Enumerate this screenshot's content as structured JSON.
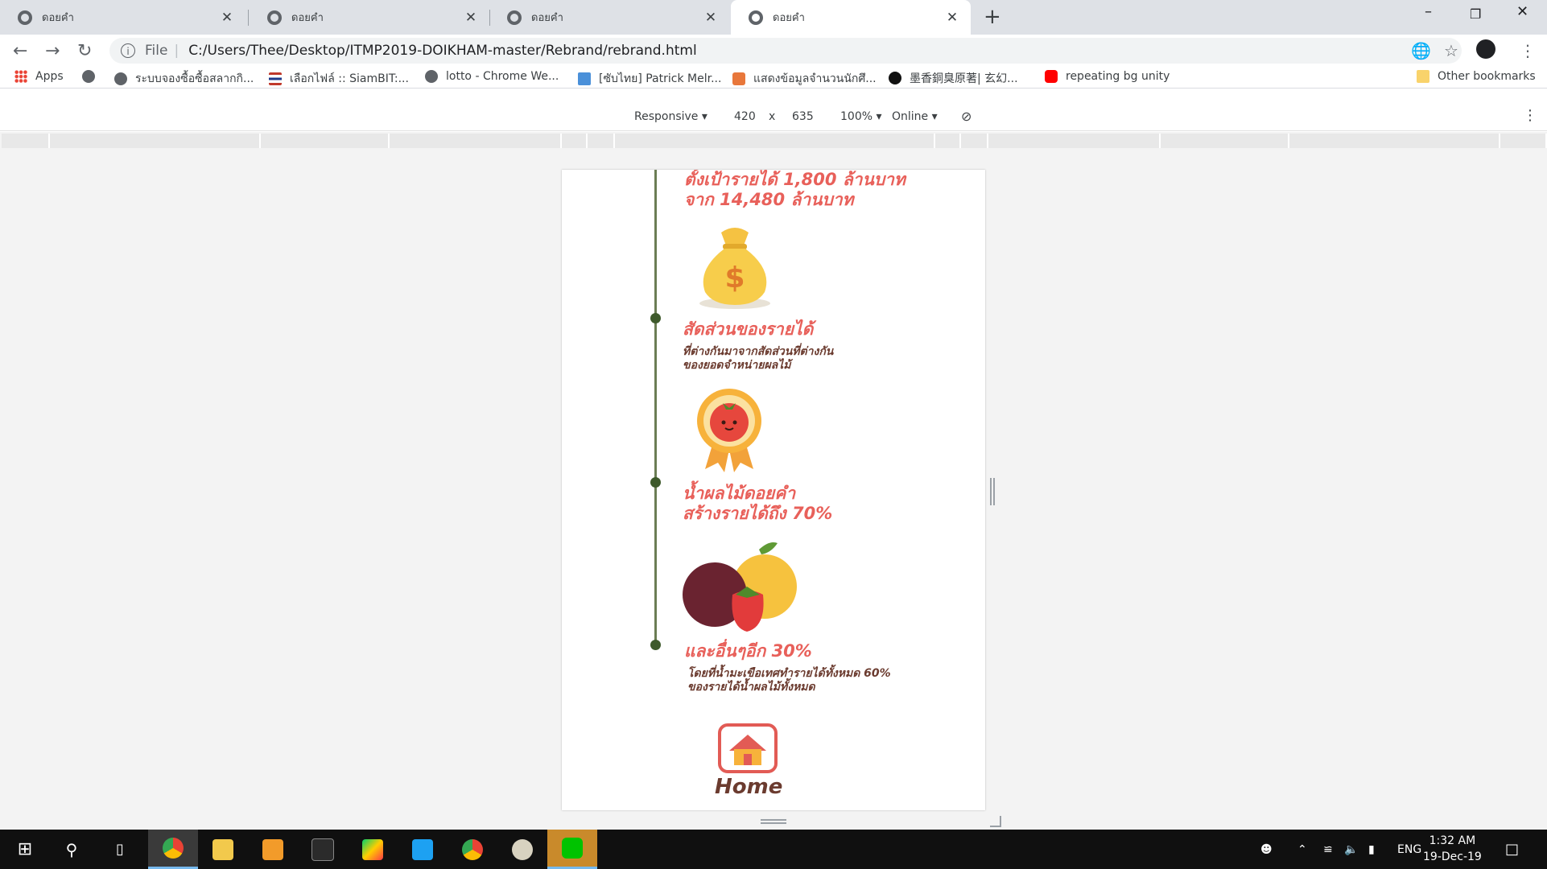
{
  "browser": {
    "tabs": [
      {
        "label": "ดอยคำ",
        "active": false
      },
      {
        "label": "ดอยคำ",
        "active": false
      },
      {
        "label": "ดอยคำ",
        "active": false
      },
      {
        "label": "ดอยคำ",
        "active": true
      }
    ],
    "tab_close_glyph": "✕",
    "new_tab_glyph": "+",
    "address": {
      "scheme_label": "File",
      "url": "C:/Users/Thee/Desktop/ITMP2019-DOIKHAM-master/Rebrand/rebrand.html"
    },
    "bookmarks": [
      {
        "label": "Apps",
        "icon": "apps-grid-icon"
      },
      {
        "label": "",
        "icon": "globe-icon"
      },
      {
        "label": "ระบบจองซื้อซื้อสลากกิ...",
        "icon": "globe-icon"
      },
      {
        "label": "เลือกไฟล์ :: SiamBIT:...",
        "icon": "thai-flag-icon"
      },
      {
        "label": "lotto - Chrome We...",
        "icon": "globe-icon"
      },
      {
        "label": "[ซับไทย] Patrick Melr...",
        "icon": "bc-icon"
      },
      {
        "label": "แสดงข้อมูลจำนวนนักศึ...",
        "icon": "chart-icon"
      },
      {
        "label": "墨香銅臭原著| 玄幻...",
        "icon": "cat-icon"
      },
      {
        "label": "repeating bg unity",
        "icon": "youtube-icon"
      }
    ],
    "other_bookmarks": "Other bookmarks"
  },
  "devtools": {
    "device_mode": "Responsive",
    "width": "420",
    "times": "x",
    "height": "635",
    "zoom": "100%",
    "throttle": "Online"
  },
  "page": {
    "income_goal_line1": "ตั้งเป้ารายได้ 1,800 ล้านบาท",
    "income_goal_line2": "จาก 14,480 ล้านบาท",
    "ratio_title": "สัดส่วนของรายได้",
    "ratio_desc_line1": "ที่ต่างกันมาจากสัดส่วนที่ต่างกัน",
    "ratio_desc_line2": "ของยอดจำหน่ายผลไม้",
    "juice_line1": "น้ำผลไม้ดอยคำ",
    "juice_line2": "สร้างรายได้ถึง 70%",
    "others_title": "และอื่นๆอีก 30%",
    "others_desc_line1": "โดยที่น้ำมะเขือเทศทำรายได้ทั้งหมด 60%",
    "others_desc_line2": "ของรายได้น้ำผลไม้ทั้งหมด",
    "home_label": "Home"
  },
  "taskbar": {
    "apps": [
      "windows-start-icon",
      "search-icon",
      "task-view-icon",
      "chrome-icon",
      "file-explorer-icon",
      "sublime-icon",
      "terminal-icon",
      "google-play-icon",
      "twitter-icon",
      "chrome-icon",
      "paint-icon",
      "line-icon"
    ],
    "language": "ENG",
    "time": "1:32 AM",
    "date": "19-Dec-19"
  }
}
